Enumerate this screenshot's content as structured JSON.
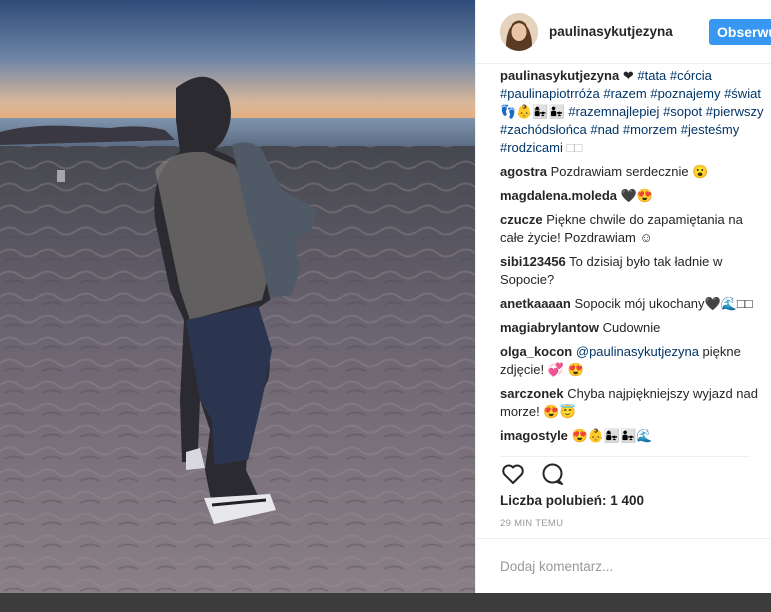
{
  "header": {
    "username": "paulinasykutjezyna",
    "follow_label": "Obserwuj"
  },
  "caption": {
    "user": "paulinasykutjezyna",
    "emoji_heart": "❤",
    "line1_tags": [
      "#tata",
      "#córcia"
    ],
    "line2_tags": [
      "#paulinapiotrróża",
      "#razem",
      "#poznajemy"
    ],
    "line3_tag1": "#świat",
    "line3_emoji": "👣👶👩‍👧👨‍👧",
    "line3_tags": [
      "#razemnajlepiej",
      "#sopot"
    ],
    "line4_tags": [
      "#pierwszy",
      "#zachódsłońca",
      "#nad",
      "#morzem"
    ],
    "line5_tags": [
      "#jesteśmy",
      "#rodzicami"
    ],
    "line5_tail": "□□"
  },
  "comments": [
    {
      "user": "agostra",
      "text": "Pozdrawiam serdecznie 😮"
    },
    {
      "user": "magdalena.moleda",
      "text": "🖤😍"
    },
    {
      "user": "czucze",
      "text": "Piękne chwile do zapamiętania na całe życie! Pozdrawiam ☺"
    },
    {
      "user": "sibi123456",
      "text": "To dzisiaj było tak ładnie w Sopocie?"
    },
    {
      "user": "anetkaaaan",
      "text": "Sopocik mój ukochany🖤🌊□□"
    },
    {
      "user": "magiabrylantow",
      "text": "Cudownie"
    },
    {
      "user": "olga_kocon",
      "mention": "@paulinasykutjezyna",
      "text": "piękne zdjęcie! 💞 😍"
    },
    {
      "user": "sarczonek",
      "text": "Chyba najpiękniejszy wyjazd nad morze! 😍😇"
    },
    {
      "user": "imagostyle",
      "text": "😍👶👩‍👧👨‍👧🌊"
    }
  ],
  "actions": {
    "like_icon": "heart-outline-icon",
    "comment_icon": "speech-bubble-icon"
  },
  "likes": "Liczba polubień: 1 400",
  "timestamp": "29 MIN TEMU",
  "add_comment_placeholder": "Dodaj komentarz...",
  "colors": {
    "accent": "#3897f0",
    "hashtag": "#003569",
    "muted": "#999999"
  }
}
